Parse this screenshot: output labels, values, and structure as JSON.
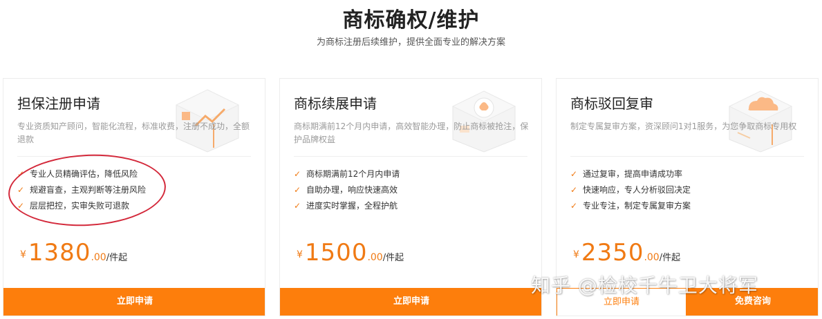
{
  "header": {
    "title": "商标确权/维护",
    "subtitle": "为商标注册后续维护，提供全面专业的解决方案"
  },
  "cards": [
    {
      "title": "担保注册申请",
      "description": "专业资质知产顾问，智能化流程，标准收费，注册不成功，全额退款",
      "features": [
        "专业人员精确评估，降低风险",
        "规避盲查，主观判断等注册风险",
        "层层把控，实审失败可退款"
      ],
      "price": {
        "currency": "¥",
        "integer": "1380",
        "decimal": ".00",
        "unit": "/件起"
      },
      "apply_label": "立即申请"
    },
    {
      "title": "商标续展申请",
      "description": "商标期满前12个月内申请，高效智能办理，防止商标被抢注，保护品牌权益",
      "features": [
        "商标期满前12个月内申请",
        "自助办理，响应快速高效",
        "进度实时掌握，全程护航"
      ],
      "price": {
        "currency": "¥",
        "integer": "1500",
        "decimal": ".00",
        "unit": "/件起"
      },
      "apply_label": "立即申请"
    },
    {
      "title": "商标驳回复审",
      "description": "制定专属复审方案，资深顾问1对1服务，为您争取商标专用权",
      "features": [
        "通过复审，提高申请成功率",
        "快速响应，专人分析驳回决定",
        "专业专注，制定专属复审方案"
      ],
      "price": {
        "currency": "¥",
        "integer": "2350",
        "decimal": ".00",
        "unit": "/件起"
      },
      "apply_label": "立即申请",
      "consult_label": "免费咨询"
    }
  ],
  "check_glyph": "✓",
  "watermark": "知乎 @检校千牛卫大将军",
  "colors": {
    "accent": "#fd7e0c",
    "annotation": "#d3283a"
  }
}
